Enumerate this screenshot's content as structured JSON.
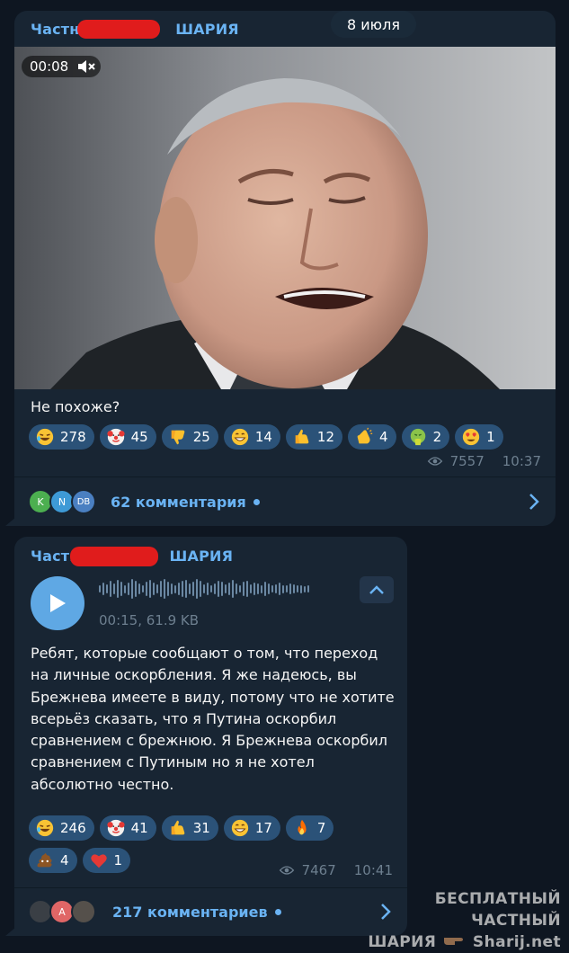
{
  "date_pill": "8 июля",
  "colors": {
    "background": "#0e1621",
    "bubble": "#182533",
    "reaction": "#2b5278",
    "accent": "#6ab3f3",
    "meta": "#6d7f8f",
    "redaction": "#e01c1c"
  },
  "posts": [
    {
      "channel_left": "Частны",
      "channel_right": "ШАРИЯ",
      "video_timer": "00:08",
      "video_muted_icon": "speaker-muted-icon",
      "caption": "Не похоже?",
      "reactions": [
        {
          "icon": "rofl-emoji",
          "count": "278"
        },
        {
          "icon": "clown-emoji",
          "count": "45"
        },
        {
          "icon": "thumbs-down-emoji",
          "count": "25"
        },
        {
          "icon": "grin-emoji",
          "count": "14"
        },
        {
          "icon": "thumbs-up-emoji",
          "count": "12"
        },
        {
          "icon": "clap-emoji",
          "count": "4"
        },
        {
          "icon": "vomit-emoji",
          "count": "2"
        },
        {
          "icon": "heart-eyes-emoji",
          "count": "1"
        }
      ],
      "views": "7557",
      "time": "10:37",
      "comment_avatars": [
        "K",
        "N",
        "DB"
      ],
      "comments": "62 комментария"
    },
    {
      "channel_left": "Частн",
      "channel_right": "ШАРИЯ",
      "audio_meta": "00:15, 61.9 KB",
      "text": "Ребят, которые сообщают о том, что переход на личные оскорбления. Я же надеюсь, вы Брежнева имеете в виду, потому что не хотите всерьёз сказать, что я Путина оскорбил сравнением с брежнюю. Я Брежнева оскорбил сравнением с Путиным но я не хотел абсолютно честно.",
      "reactions_row1": [
        {
          "icon": "rofl-emoji",
          "count": "246"
        },
        {
          "icon": "clown-emoji",
          "count": "41"
        },
        {
          "icon": "thumbs-up-emoji",
          "count": "31"
        },
        {
          "icon": "grin-emoji",
          "count": "17"
        },
        {
          "icon": "fire-emoji",
          "count": "7"
        }
      ],
      "reactions_row2": [
        {
          "icon": "poop-emoji",
          "count": "4"
        },
        {
          "icon": "heart-emoji",
          "count": "1"
        }
      ],
      "views": "7467",
      "time": "10:41",
      "comment_avatars": [
        "",
        "A",
        ""
      ],
      "comments": "217 комментариев"
    }
  ],
  "watermark": {
    "line1": "БЕСПЛАТНЫЙ ЧАСТНЫЙ",
    "line2_left": "ШАРИЯ",
    "line2_right": "Sharij.net"
  }
}
